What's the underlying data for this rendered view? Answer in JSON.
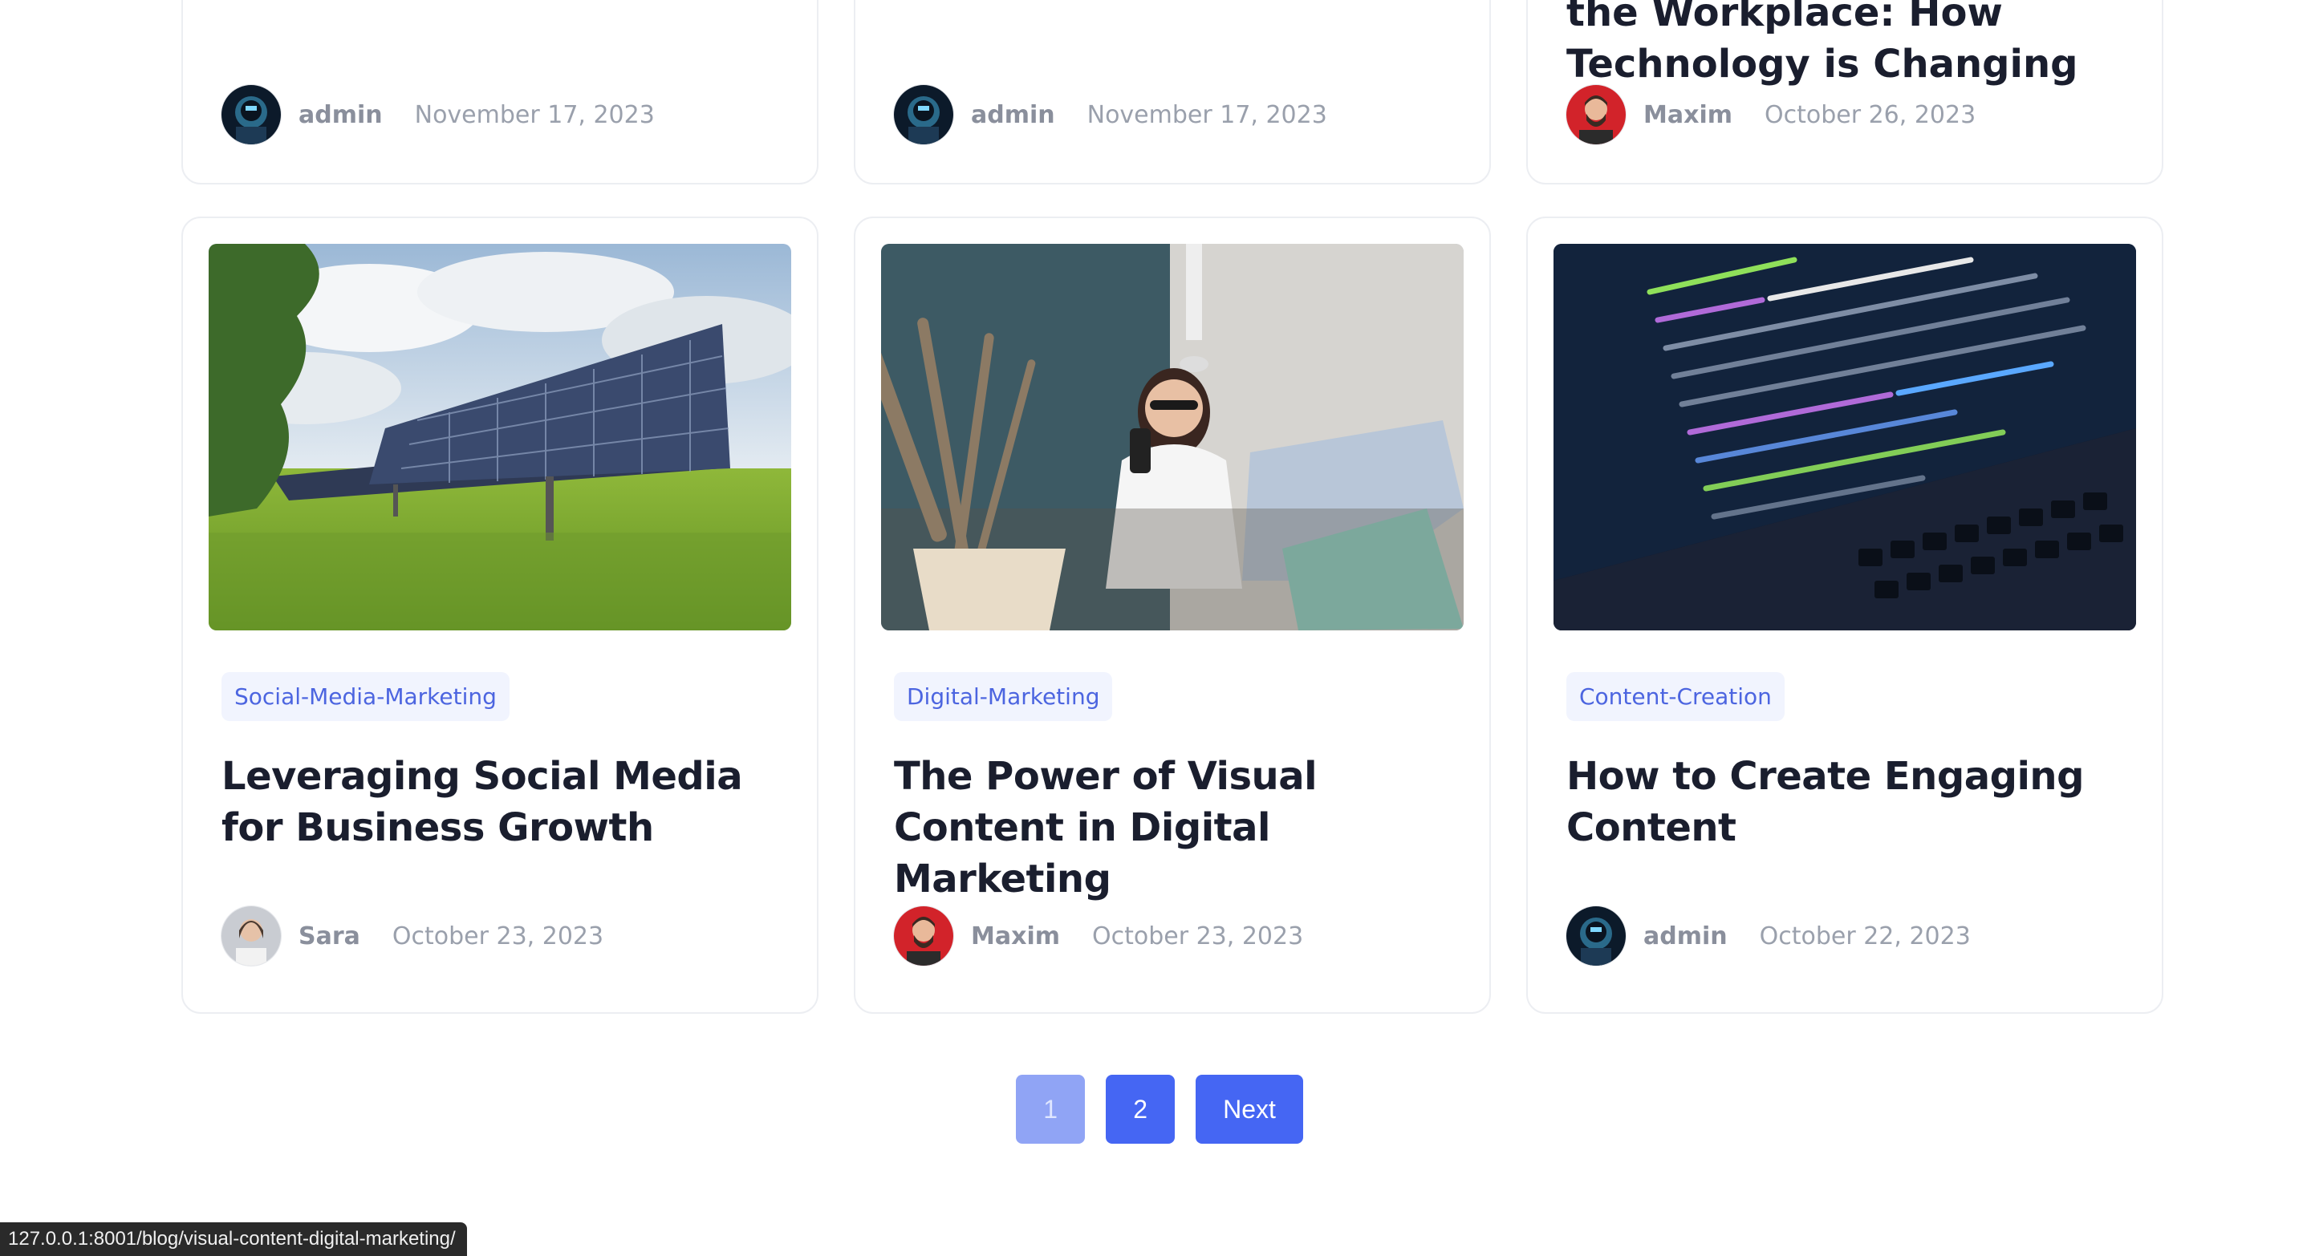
{
  "top_row": [
    {
      "author": "admin",
      "date": "November 17, 2023",
      "avatar": "robot-avatar"
    },
    {
      "author": "admin",
      "date": "November 17, 2023",
      "avatar": "robot-avatar"
    },
    {
      "title": "the Workplace: How Technology is Changing",
      "author": "Maxim",
      "date": "October 26, 2023",
      "avatar": "man-red-avatar"
    }
  ],
  "posts": [
    {
      "image": "solar-panels-image",
      "category": "Social-Media-Marketing",
      "title": "Leveraging Social Media for Business Growth",
      "author": "Sara",
      "date": "October 23, 2023",
      "avatar": "woman-avatar"
    },
    {
      "image": "woman-laptop-image",
      "category": "Digital-Marketing",
      "title": "The Power of Visual Content in Digital Marketing",
      "author": "Maxim",
      "date": "October 23, 2023",
      "avatar": "man-red-avatar"
    },
    {
      "image": "code-laptop-image",
      "category": "Content-Creation",
      "title": "How to Create Engaging Content",
      "author": "admin",
      "date": "October 22, 2023",
      "avatar": "robot-avatar"
    }
  ],
  "pagination": {
    "current": "1",
    "page2": "2",
    "next": "Next"
  },
  "status_url": "127.0.0.1:8001/blog/visual-content-digital-marketing/",
  "colors": {
    "accent": "#4566f3",
    "accent_disabled": "#90a4f5",
    "tag_bg": "#f1f4fe",
    "tag_text": "#4c65e0"
  }
}
